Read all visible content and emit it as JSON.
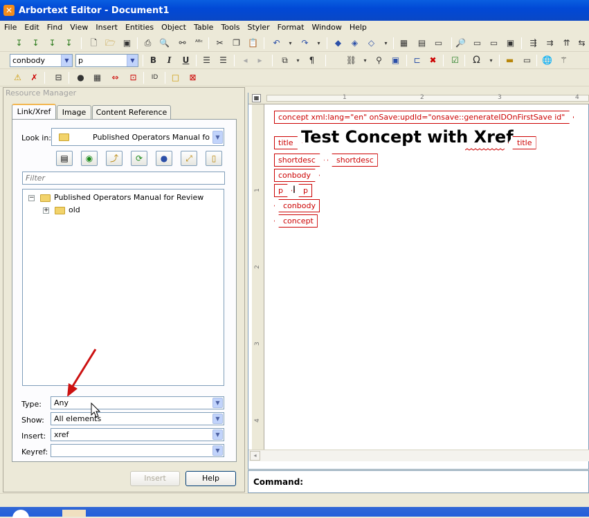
{
  "window": {
    "title": "Arbortext Editor - Document1"
  },
  "menu": [
    "File",
    "Edit",
    "Find",
    "View",
    "Insert",
    "Entities",
    "Object",
    "Table",
    "Tools",
    "Styler",
    "Format",
    "Window",
    "Help"
  ],
  "toolbar2": {
    "element_combo": "conbody",
    "para_combo": "p",
    "bold": "B",
    "italic": "I",
    "underline": "U",
    "pilcrow": "¶",
    "omega": "Ω"
  },
  "resource_manager": {
    "title": "Resource Manager",
    "tabs": [
      "Link/Xref",
      "Image",
      "Content Reference"
    ],
    "look_in_label": "Look in:",
    "look_in_value": "Published Operators Manual fo",
    "filter_placeholder": "Filter",
    "tree": {
      "root": "Published Operators Manual for Review",
      "child": "old"
    },
    "type_label": "Type:",
    "type_value": "Any",
    "show_label": "Show:",
    "show_value": "All elements",
    "insert_label": "Insert:",
    "insert_value": "xref",
    "keyref_label": "Keyref:",
    "keyref_value": "",
    "insert_button": "Insert",
    "help_button": "Help"
  },
  "editor": {
    "ruler_marks": [
      "1",
      "2",
      "3",
      "4"
    ],
    "vruler_marks": [
      "1",
      "2",
      "3",
      "4"
    ],
    "concept_open": "concept xml:lang=\"en\" onSave:updId=\"onsave::generateIDOnFirstSave id\"",
    "title_open": "title",
    "title_text": "Test Concept with Xref",
    "title_close": "title",
    "shortdesc_open": "shortdesc",
    "shortdesc_close": "shortdesc",
    "conbody_open": "conbody",
    "p_open": "p",
    "p_close": "p",
    "conbody_close": "conbody",
    "concept_close": "concept"
  },
  "command": {
    "label": "Command:"
  }
}
